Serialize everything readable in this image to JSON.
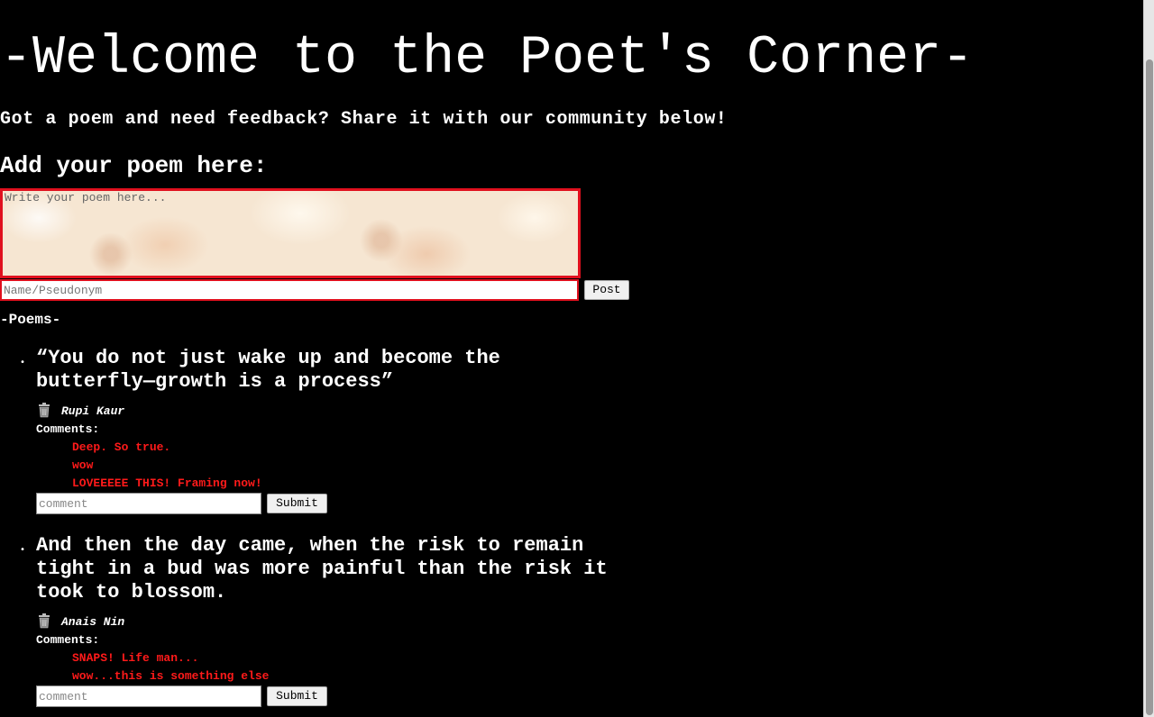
{
  "header": {
    "title": "-Welcome to the Poet's Corner-",
    "tagline": "Got a poem and need feedback? Share it with our community below!"
  },
  "form": {
    "heading": "Add your poem here:",
    "poem_placeholder": "Write your poem here...",
    "name_placeholder": "Name/Pseudonym",
    "post_label": "Post"
  },
  "poems_heading": "-Poems-",
  "poems": [
    {
      "text": "“You do not just wake up and become the butterfly—growth is a process”",
      "author": "Rupi Kaur",
      "comments_label": "Comments:",
      "comments": [
        "Deep. So true.",
        "wow",
        "LOVEEEEE THIS! Framing now!"
      ],
      "comment_placeholder": "comment",
      "submit_label": "Submit"
    },
    {
      "text": "And then the day came, when the risk to remain tight in a bud was more painful than the risk it took to blossom.",
      "author": "Anais Nin",
      "comments_label": "Comments:",
      "comments": [
        "SNAPS! Life man...",
        "wow...this is something else"
      ],
      "comment_placeholder": "comment",
      "submit_label": "Submit"
    }
  ],
  "colors": {
    "background": "#000000",
    "text": "#ffffff",
    "comment_text": "#ff1a1a",
    "form_border": "#e0101e"
  },
  "icons": {
    "delete": "trash-icon"
  }
}
